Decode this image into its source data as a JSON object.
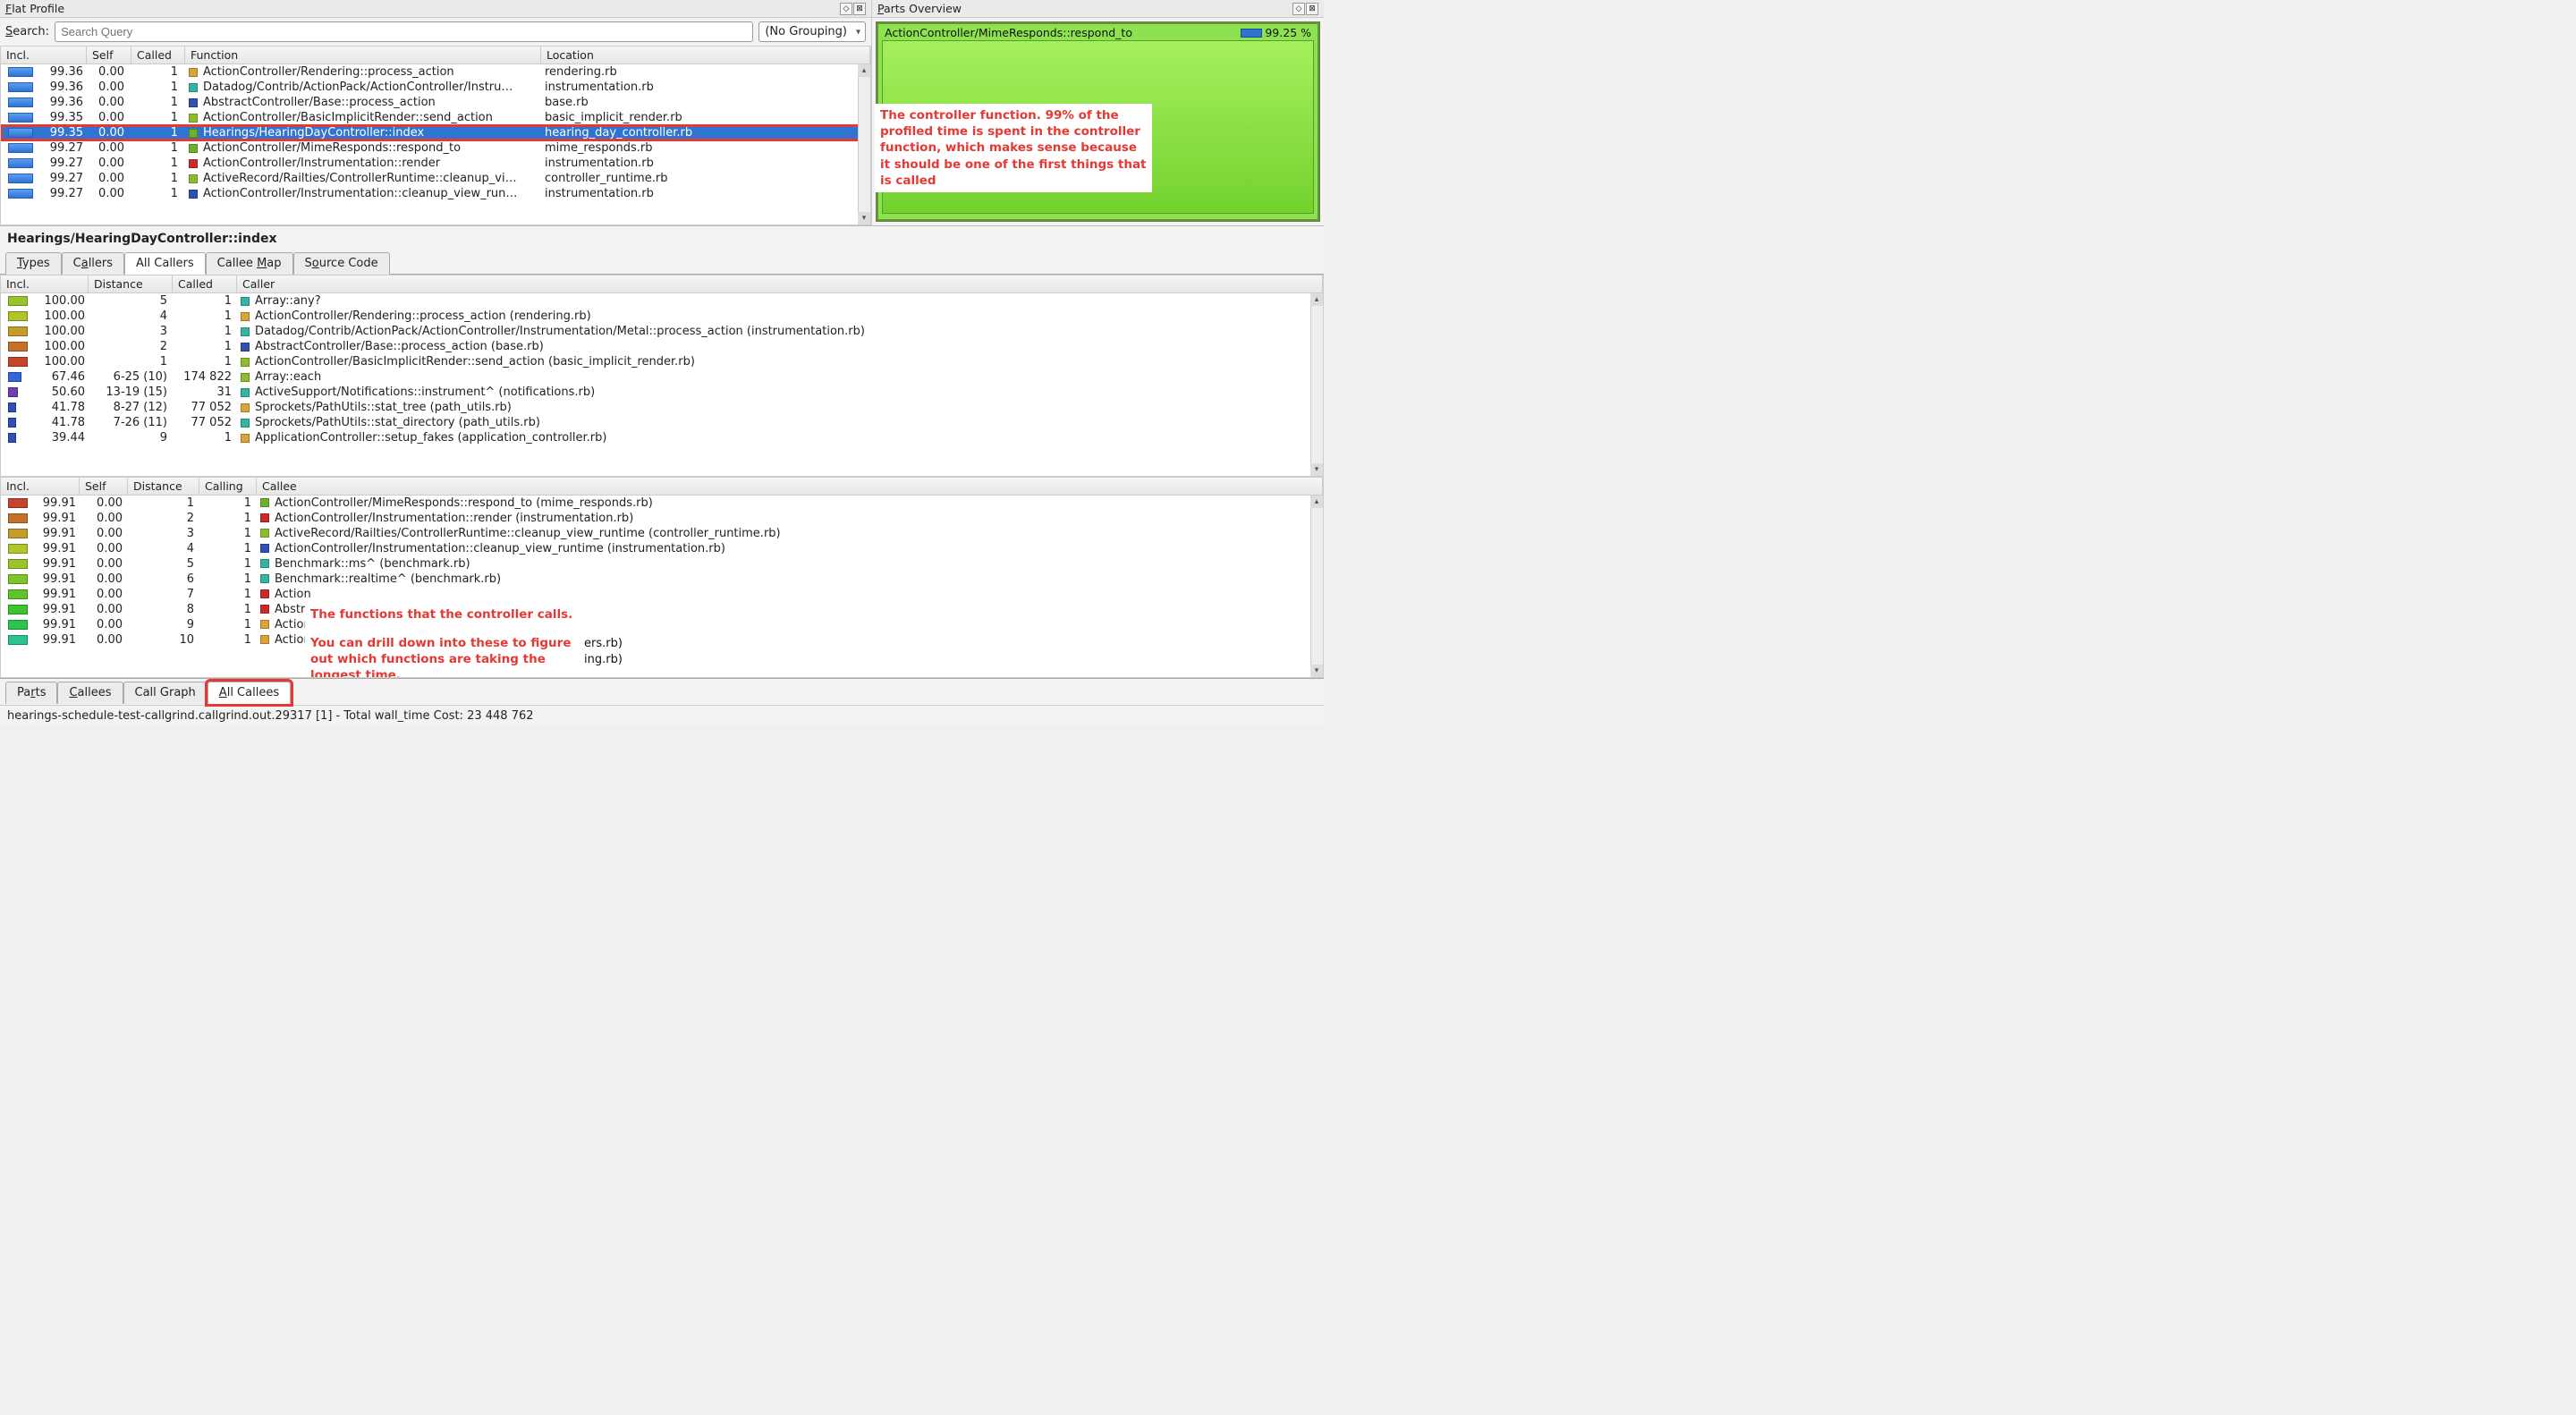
{
  "panels": {
    "flat_profile_title": "Flat Profile",
    "parts_overview_title": "Parts Overview"
  },
  "search": {
    "label": "Search:",
    "placeholder": "Search Query",
    "grouping": "(No Grouping)"
  },
  "flat_table": {
    "headers": {
      "incl": "Incl.",
      "self": "Self",
      "called": "Called",
      "function": "Function",
      "location": "Location"
    },
    "rows": [
      {
        "incl": "99.36",
        "self": "0.00",
        "called": "1",
        "color": "#d9a538",
        "function": "ActionController/Rendering::process_action",
        "location": "rendering.rb"
      },
      {
        "incl": "99.36",
        "self": "0.00",
        "called": "1",
        "color": "#36b3a3",
        "function": "Datadog/Contrib/ActionPack/ActionController/Instru…",
        "location": "instrumentation.rb"
      },
      {
        "incl": "99.36",
        "self": "0.00",
        "called": "1",
        "color": "#2f4fb3",
        "function": "AbstractController/Base::process_action",
        "location": "base.rb"
      },
      {
        "incl": "99.35",
        "self": "0.00",
        "called": "1",
        "color": "#8bbd2e",
        "function": "ActionController/BasicImplicitRender::send_action",
        "location": "basic_implicit_render.rb"
      },
      {
        "incl": "99.35",
        "self": "0.00",
        "called": "1",
        "color": "#6bb32a",
        "function": "Hearings/HearingDayController::index",
        "location": "hearing_day_controller.rb",
        "selected": true,
        "highlighted": true
      },
      {
        "incl": "99.27",
        "self": "0.00",
        "called": "1",
        "color": "#6bb32a",
        "function": "ActionController/MimeResponds::respond_to",
        "location": "mime_responds.rb"
      },
      {
        "incl": "99.27",
        "self": "0.00",
        "called": "1",
        "color": "#cc2a2a",
        "function": "ActionController/Instrumentation::render",
        "location": "instrumentation.rb"
      },
      {
        "incl": "99.27",
        "self": "0.00",
        "called": "1",
        "color": "#8bbd2e",
        "function": "ActiveRecord/Railties/ControllerRuntime::cleanup_vi…",
        "location": "controller_runtime.rb"
      },
      {
        "incl": "99.27",
        "self": "0.00",
        "called": "1",
        "color": "#2f4fb3",
        "function": "ActionController/Instrumentation::cleanup_view_run…",
        "location": "instrumentation.rb"
      }
    ]
  },
  "parts_overview": {
    "label": "ActionController/MimeResponds::respond_to",
    "percent": "99.25 %"
  },
  "annotation_controller": "The controller function. 99% of the profiled time is spent in the controller function, which makes sense because it should be one of the first things that is called",
  "detail": {
    "title": "Hearings/HearingDayController::index",
    "tabs": {
      "types": "Types",
      "callers": "Callers",
      "all_callers": "All Callers",
      "callee_map": "Callee Map",
      "source_code": "Source Code"
    }
  },
  "callers_table": {
    "headers": {
      "incl": "Incl.",
      "distance": "Distance",
      "called": "Called",
      "caller": "Caller"
    },
    "rows": [
      {
        "bar": "#9ac52a",
        "incl": "100.00",
        "distance": "5",
        "called": "1",
        "color": "#36b3a3",
        "caller": "Array::any?"
      },
      {
        "bar": "#afc52a",
        "incl": "100.00",
        "distance": "4",
        "called": "1",
        "color": "#d9a538",
        "caller": "ActionController/Rendering::process_action (rendering.rb)"
      },
      {
        "bar": "#c59e2a",
        "incl": "100.00",
        "distance": "3",
        "called": "1",
        "color": "#36b3a3",
        "caller": "Datadog/Contrib/ActionPack/ActionController/Instrumentation/Metal::process_action (instrumentation.rb)"
      },
      {
        "bar": "#c5712a",
        "incl": "100.00",
        "distance": "2",
        "called": "1",
        "color": "#2f4fb3",
        "caller": "AbstractController/Base::process_action (base.rb)"
      },
      {
        "bar": "#c5442a",
        "incl": "100.00",
        "distance": "1",
        "called": "1",
        "color": "#8bbd2e",
        "caller": "ActionController/BasicImplicitRender::send_action (basic_implicit_render.rb)"
      },
      {
        "bar": "#3266d9",
        "incl": "67.46",
        "distance": "6-25 (10)",
        "called": "174 822",
        "color": "#8bbd2e",
        "caller": "Array::each"
      },
      {
        "bar": "#6f3fb3",
        "incl": "50.60",
        "distance": "13-19 (15)",
        "called": "31",
        "color": "#36b3a3",
        "caller": "ActiveSupport/Notifications::instrument^ (notifications.rb)"
      },
      {
        "bar": "#2f4fb3",
        "incl": "41.78",
        "distance": "8-27 (12)",
        "called": "77 052",
        "color": "#d9a538",
        "caller": "Sprockets/PathUtils::stat_tree (path_utils.rb)"
      },
      {
        "bar": "#2f4fb3",
        "incl": "41.78",
        "distance": "7-26 (11)",
        "called": "77 052",
        "color": "#36b3a3",
        "caller": "Sprockets/PathUtils::stat_directory (path_utils.rb)"
      },
      {
        "bar": "#2f4fb3",
        "incl": "39.44",
        "distance": "9",
        "called": "1",
        "color": "#d9a538",
        "caller": "ApplicationController::setup_fakes (application_controller.rb)"
      }
    ]
  },
  "callees_table": {
    "headers": {
      "incl": "Incl.",
      "self": "Self",
      "distance": "Distance",
      "calling": "Calling",
      "callee": "Callee"
    },
    "rows": [
      {
        "bar": "#c5442a",
        "incl": "99.91",
        "self": "0.00",
        "distance": "1",
        "calling": "1",
        "color": "#6bb32a",
        "callee": "ActionController/MimeResponds::respond_to (mime_responds.rb)"
      },
      {
        "bar": "#c5712a",
        "incl": "99.91",
        "self": "0.00",
        "distance": "2",
        "calling": "1",
        "color": "#cc2a2a",
        "callee": "ActionController/Instrumentation::render (instrumentation.rb)"
      },
      {
        "bar": "#c59e2a",
        "incl": "99.91",
        "self": "0.00",
        "distance": "3",
        "calling": "1",
        "color": "#8bbd2e",
        "callee": "ActiveRecord/Railties/ControllerRuntime::cleanup_view_runtime (controller_runtime.rb)"
      },
      {
        "bar": "#afc52a",
        "incl": "99.91",
        "self": "0.00",
        "distance": "4",
        "calling": "1",
        "color": "#2f4fb3",
        "callee": "ActionController/Instrumentation::cleanup_view_runtime (instrumentation.rb)"
      },
      {
        "bar": "#9ac52a",
        "incl": "99.91",
        "self": "0.00",
        "distance": "5",
        "calling": "1",
        "color": "#36b3a3",
        "callee": "Benchmark::ms^ (benchmark.rb)"
      },
      {
        "bar": "#7ec52a",
        "incl": "99.91",
        "self": "0.00",
        "distance": "6",
        "calling": "1",
        "color": "#36b3a3",
        "callee": "Benchmark::realtime^ (benchmark.rb)"
      },
      {
        "bar": "#5ec52a",
        "incl": "99.91",
        "self": "0.00",
        "distance": "7",
        "calling": "1",
        "color": "#cc2a2a",
        "callee": "Action "
      },
      {
        "bar": "#3cc52a",
        "incl": "99.91",
        "self": "0.00",
        "distance": "8",
        "calling": "1",
        "color": "#cc2a2a",
        "callee": "Abstra"
      },
      {
        "bar": "#2ac54c",
        "incl": "99.91",
        "self": "0.00",
        "distance": "9",
        "calling": "1",
        "color": "#d9a538",
        "callee": "Action "
      },
      {
        "bar": "#2ac58e",
        "incl": "99.91",
        "self": "0.00",
        "distance": "10",
        "calling": "1",
        "color": "#d9a538",
        "callee": "Action"
      }
    ]
  },
  "annotation_callees_line1": "The functions that the controller calls.",
  "annotation_callees_line2": "You can drill down into these to figure out which functions are taking the longest time.",
  "annotation_callees_frag1": "ers.rb)",
  "annotation_callees_frag2": "ing.rb)",
  "bottom_tabs": {
    "parts": "Parts",
    "callees": "Callees",
    "call_graph": "Call Graph",
    "all_callees": "All Callees"
  },
  "status_bar": "hearings-schedule-test-callgrind.callgrind.out.29317 [1] - Total wall_time Cost: 23 448 762"
}
